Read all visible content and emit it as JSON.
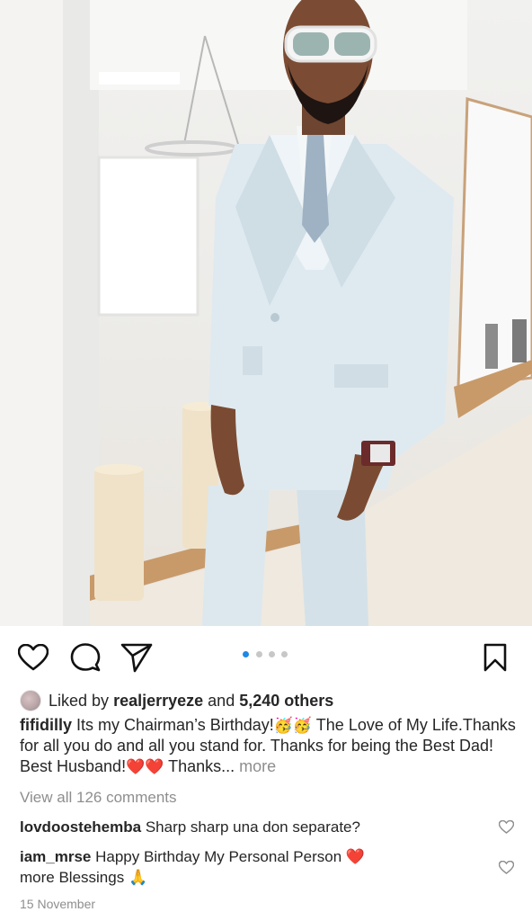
{
  "post": {
    "image_alt": "man in light blue double-breasted suit with white sunglasses",
    "carousel": {
      "total": 4,
      "active": 1
    },
    "icons": {
      "like": "heart-outline-icon",
      "comment": "comment-bubble-icon",
      "share": "paper-plane-icon",
      "save": "bookmark-icon"
    }
  },
  "likes": {
    "prefix": "Liked by",
    "user": "realjerryeze",
    "joiner": "and",
    "count": "5,240 others"
  },
  "caption": {
    "username": "fifidilly",
    "text_1": "Its my Chairman’s Birthday!",
    "emoji_1": "🥳🥳",
    "text_2": "The Love of My Life.Thanks for all you do and all you stand for. Thanks for being the Best Dad! Best Husband!",
    "emoji_2": "❤️❤️",
    "text_3": "Thanks...",
    "more": "more"
  },
  "view_all_comments": "View all 126 comments",
  "comments": [
    {
      "user": "lovdoostehemba",
      "text": "Sharp sharp una don separate?"
    },
    {
      "user": "iam_mrse",
      "text": "Happy Birthday My Personal Person",
      "emoji_1": "❤️",
      "text_2": "more Blessings",
      "emoji_2": "🙏"
    }
  ],
  "date": "15 November",
  "colors": {
    "text": "#262626",
    "muted": "#8e8e8e",
    "accent": "#1e88e5",
    "heart": "#e0245e"
  }
}
